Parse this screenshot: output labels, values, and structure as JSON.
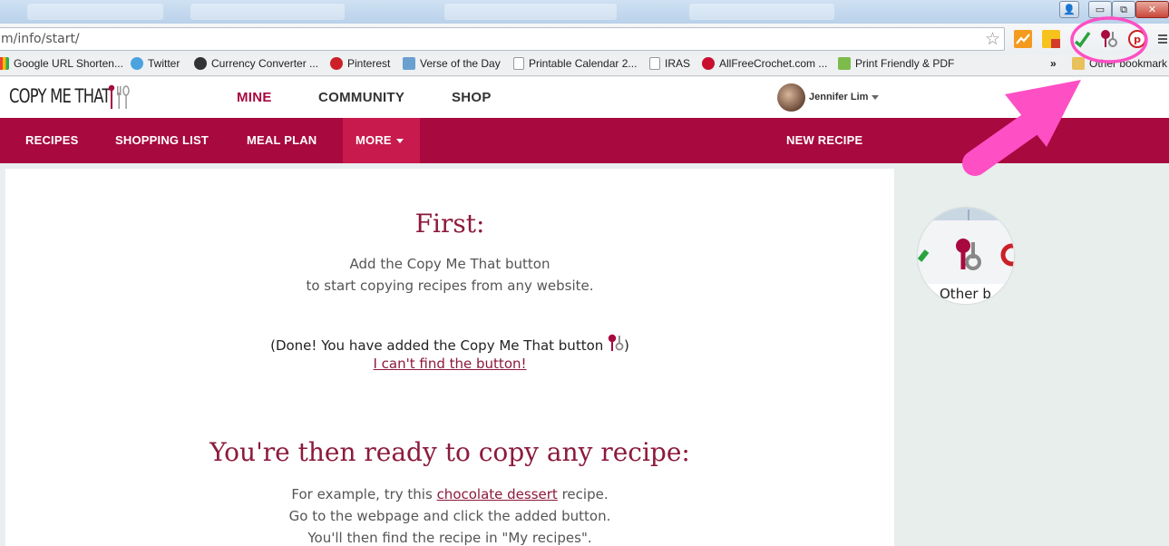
{
  "window": {
    "minimize_glyph": "▭",
    "restore_glyph": "⧉",
    "close_glyph": "✕",
    "user_glyph": "👤"
  },
  "browser": {
    "url": "m/info/start/",
    "bookmarks": [
      "Google URL Shorten...",
      "Twitter",
      "Currency Converter ...",
      "Pinterest",
      "Verse of the Day",
      "Printable Calendar 2...",
      "IRAS",
      "AllFreeCrochet.com ...",
      "Print Friendly & PDF"
    ],
    "overflow": "»",
    "other_bookmarks": "Other bookmark",
    "extensions": [
      "trend-extension-icon",
      "yellow-extension-icon",
      "check-extension-icon",
      "copy-me-that-extension-icon",
      "pinterest-extension-icon",
      "menu-icon"
    ]
  },
  "site": {
    "logo": "COPY ME THAT",
    "top_nav": [
      "MINE",
      "COMMUNITY",
      "SHOP"
    ],
    "user": "Jennifer Lim",
    "sub_nav": [
      "RECIPES",
      "SHOPPING LIST",
      "MEAL PLAN",
      "MORE"
    ],
    "new_recipe": "NEW RECIPE"
  },
  "content": {
    "first_heading": "First:",
    "first_line1": "Add the Copy Me That button",
    "first_line2": "to start copying recipes from any website.",
    "done_before": "(Done! You have added the Copy Me That button",
    "done_after": ")",
    "cant_find": "I can't find the button!",
    "ready_heading": "You're then ready to copy any recipe:",
    "example_before": "For example, try this",
    "example_link": "chocolate dessert",
    "example_after": "recipe.",
    "goto_line": "Go to the webpage and click the added button.",
    "find_line": "You'll then find the recipe in \"My recipes\"."
  },
  "zoom": {
    "label": "Other b"
  },
  "colors": {
    "brand": "#a8093f",
    "heading": "#8c1a3c",
    "annotation": "#ff4fc4"
  }
}
